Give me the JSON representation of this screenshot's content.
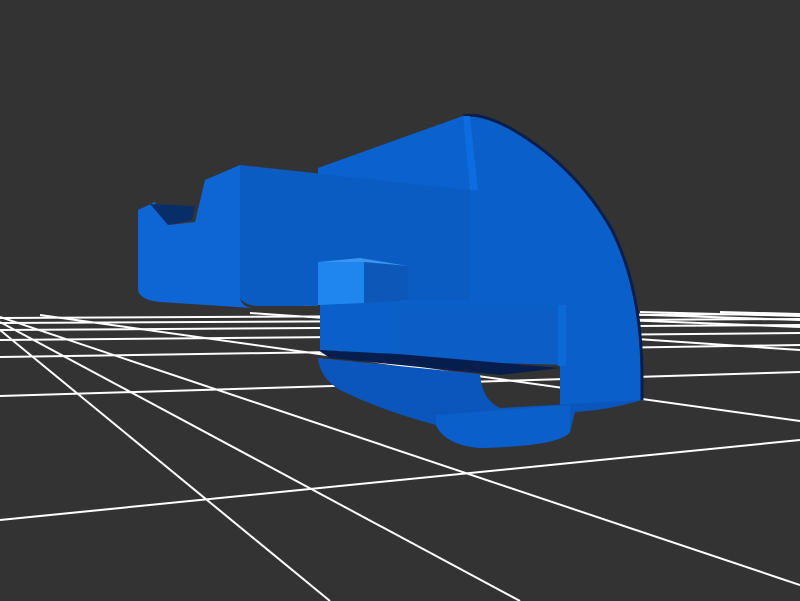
{
  "viewer": {
    "background": "#333333",
    "grid_color": "#ffffff",
    "grid_visible": true
  },
  "model": {
    "base_color": "#0a5fc8",
    "light_color": "#1f86f0",
    "dark_color": "#0a4aa6",
    "shadow_color": "#061e4e"
  }
}
